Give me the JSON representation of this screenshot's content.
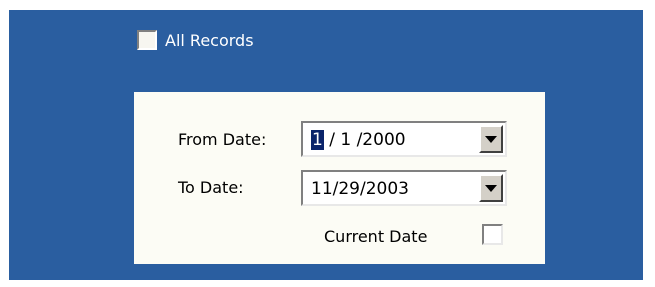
{
  "colors": {
    "panel_background": "#2a5ea0",
    "form_background": "#fcfcf5",
    "selection": "#0a246a"
  },
  "all_records": {
    "label": "All Records",
    "checked": false
  },
  "from_date": {
    "label": "From Date:",
    "selected_part": "1",
    "rest": " / 1 /2000",
    "dropdown_icon": "chevron-down-icon"
  },
  "to_date": {
    "label": "To Date:",
    "value": "11/29/2003",
    "dropdown_icon": "chevron-down-icon"
  },
  "current_date": {
    "label": "Current Date",
    "checked": false
  }
}
